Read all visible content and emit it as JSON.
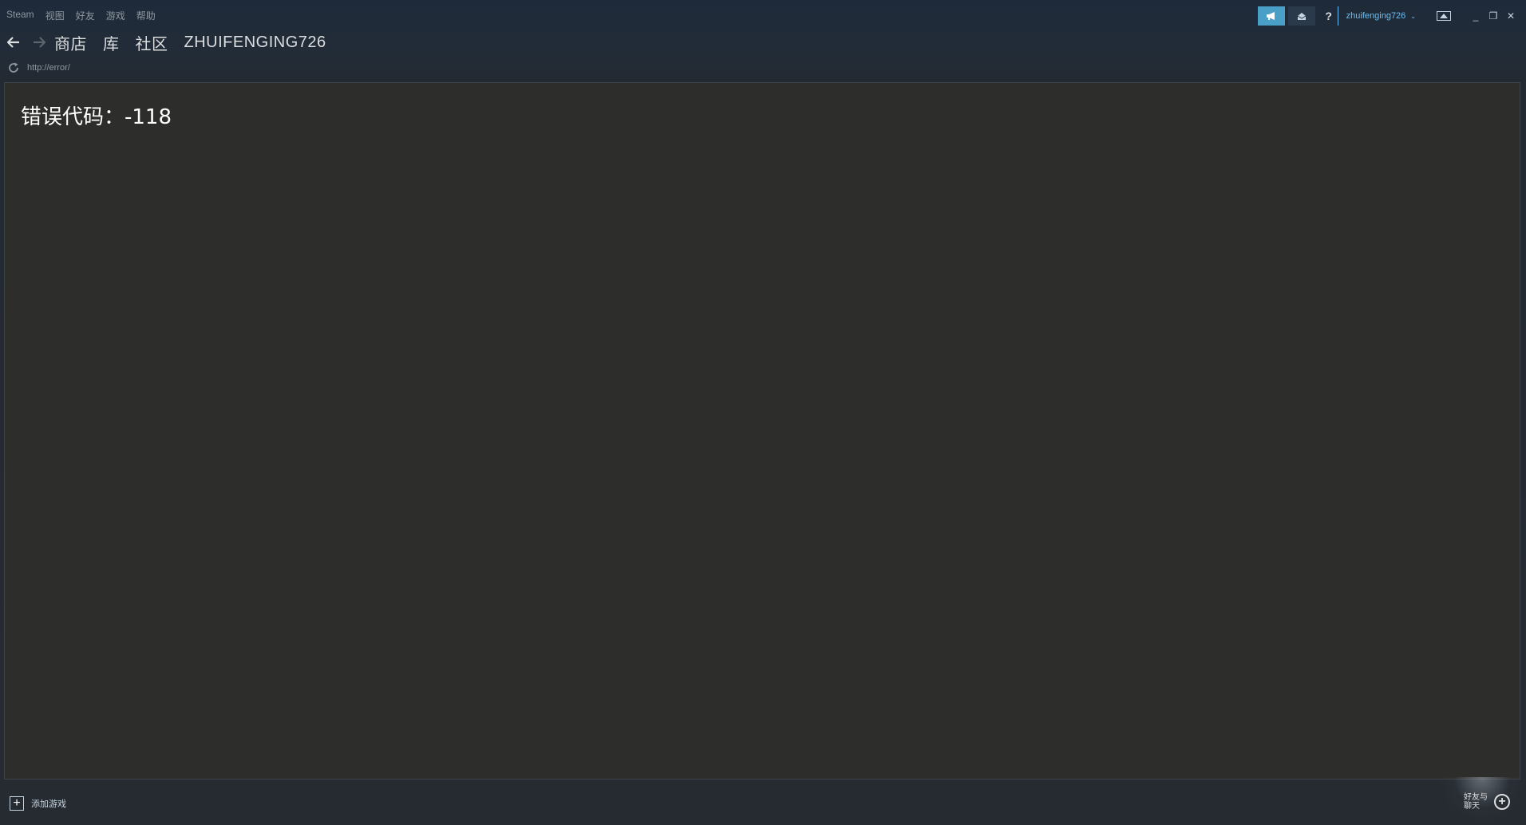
{
  "menubar": {
    "items": [
      "Steam",
      "视图",
      "好友",
      "游戏",
      "帮助"
    ]
  },
  "top_right": {
    "announce_icon": "megaphone-icon",
    "mail_icon": "envelope-icon",
    "help_label": "?",
    "account_name": "zhuifenging726",
    "account_chevron": "⌄",
    "bigpicture_icon": "big-picture-icon",
    "minimize": "_",
    "restore": "❐",
    "close": "✕"
  },
  "nav": {
    "back_icon": "back-arrow-icon",
    "forward_icon": "forward-arrow-icon",
    "tabs": [
      "商店",
      "库",
      "社区",
      "ZHUIFENGING726"
    ]
  },
  "urlbar": {
    "reload_icon": "reload-icon",
    "url": "http://error/"
  },
  "content": {
    "error_title": "错误代码：-118"
  },
  "bottombar": {
    "add_game_icon": "plus-icon",
    "add_game_label": "添加游戏",
    "friends_chat_label": "好友与聊天",
    "friends_chat_icon": "plus-circle-icon"
  },
  "colors": {
    "accent": "#67c1f5",
    "announce_bg": "#4a9fc7",
    "content_bg": "#2d2d2b",
    "chrome_bg": "#1b2838"
  }
}
